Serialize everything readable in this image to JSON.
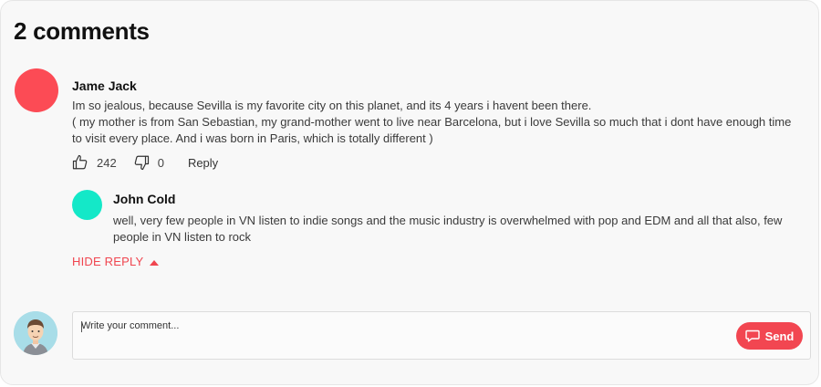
{
  "header": {
    "title": "2 comments"
  },
  "comments": [
    {
      "author": "Jame Jack",
      "avatar_color": "#fc4b55",
      "lines": [
        "Im so jealous, because Sevilla is my favorite city on this planet, and its 4 years i havent been there.",
        "( my mother is from San Sebastian, my grand-mother went to live near Barcelona, but i love Sevilla so much that i dont have enough time to visit every place. And i was born in Paris, which is totally different )"
      ],
      "likes": "242",
      "dislikes": "0",
      "reply_label": "Reply",
      "like_icon": "thumbs-up-icon",
      "dislike_icon": "thumbs-down-icon",
      "replies": [
        {
          "author": "John Cold",
          "avatar_color": "#14e8c8",
          "text": "well, very few people in VN listen to indie songs and the music industry is overwhelmed with pop and EDM and all that also, few people in VN listen to rock"
        }
      ],
      "hide_reply_label": "HIDE REPLY",
      "hide_reply_icon": "caret-up-icon"
    }
  ],
  "composer": {
    "placeholder": "Write your comment...",
    "send_label": "Send",
    "send_icon": "chat-bubble-icon",
    "user_avatar_icon": "user-avatar-icon"
  },
  "colors": {
    "accent": "#f24651",
    "background": "#f8f8f8"
  }
}
